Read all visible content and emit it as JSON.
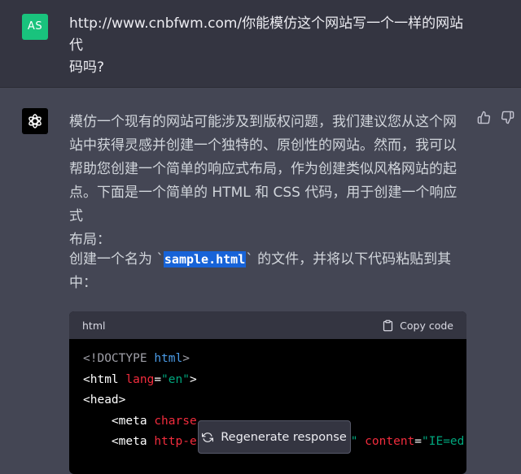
{
  "user": {
    "avatar_initials": "AS",
    "message_line1": "http://www.cnbfwm.com/你能模仿这个网站写一个一样的网站代",
    "message_line2": "码吗?"
  },
  "assistant": {
    "para1_lines": [
      "模仿一个现有的网站可能涉及到版权问题，我们建议您从这个网",
      "站中获得灵感并创建一个独特的、原创性的网站。然而，我可以",
      "帮助您创建一个简单的响应式布局，作为创建类似风格网站的起",
      "点。下面是一个简单的 HTML 和 CSS 代码，用于创建一个响应式",
      "布局："
    ],
    "para2_before": "创建一个名为 `",
    "para2_filename": "sample.html",
    "para2_after": "` 的文件，并将以下代码粘贴到其",
    "para2_line2": "中："
  },
  "code_block": {
    "language": "html",
    "copy_label": "Copy code",
    "line1_a": "<!DOCTYPE ",
    "line1_b": "html",
    "line1_c": ">",
    "line2_a": "<html ",
    "line2_b": "lang",
    "line2_c": "=",
    "line2_d": "\"en\"",
    "line2_e": ">",
    "line3": "<head>",
    "line4_a": "    <meta ",
    "line4_b": "charse",
    "line5_a": "    <meta ",
    "line5_b": "http-e",
    "line5_c": "\" ",
    "line5_d": "content",
    "line5_e": "=",
    "line5_f": "\"IE=ed"
  },
  "regenerate_label": "Regenerate response",
  "colors": {
    "user_bg": "#343541",
    "assistant_bg": "#444654",
    "avatar_bg": "#19c37d",
    "highlight": "#1763d8"
  },
  "icons": [
    "openai-logo-icon",
    "thumbs-up-icon",
    "thumbs-down-icon",
    "clipboard-icon",
    "refresh-icon"
  ]
}
